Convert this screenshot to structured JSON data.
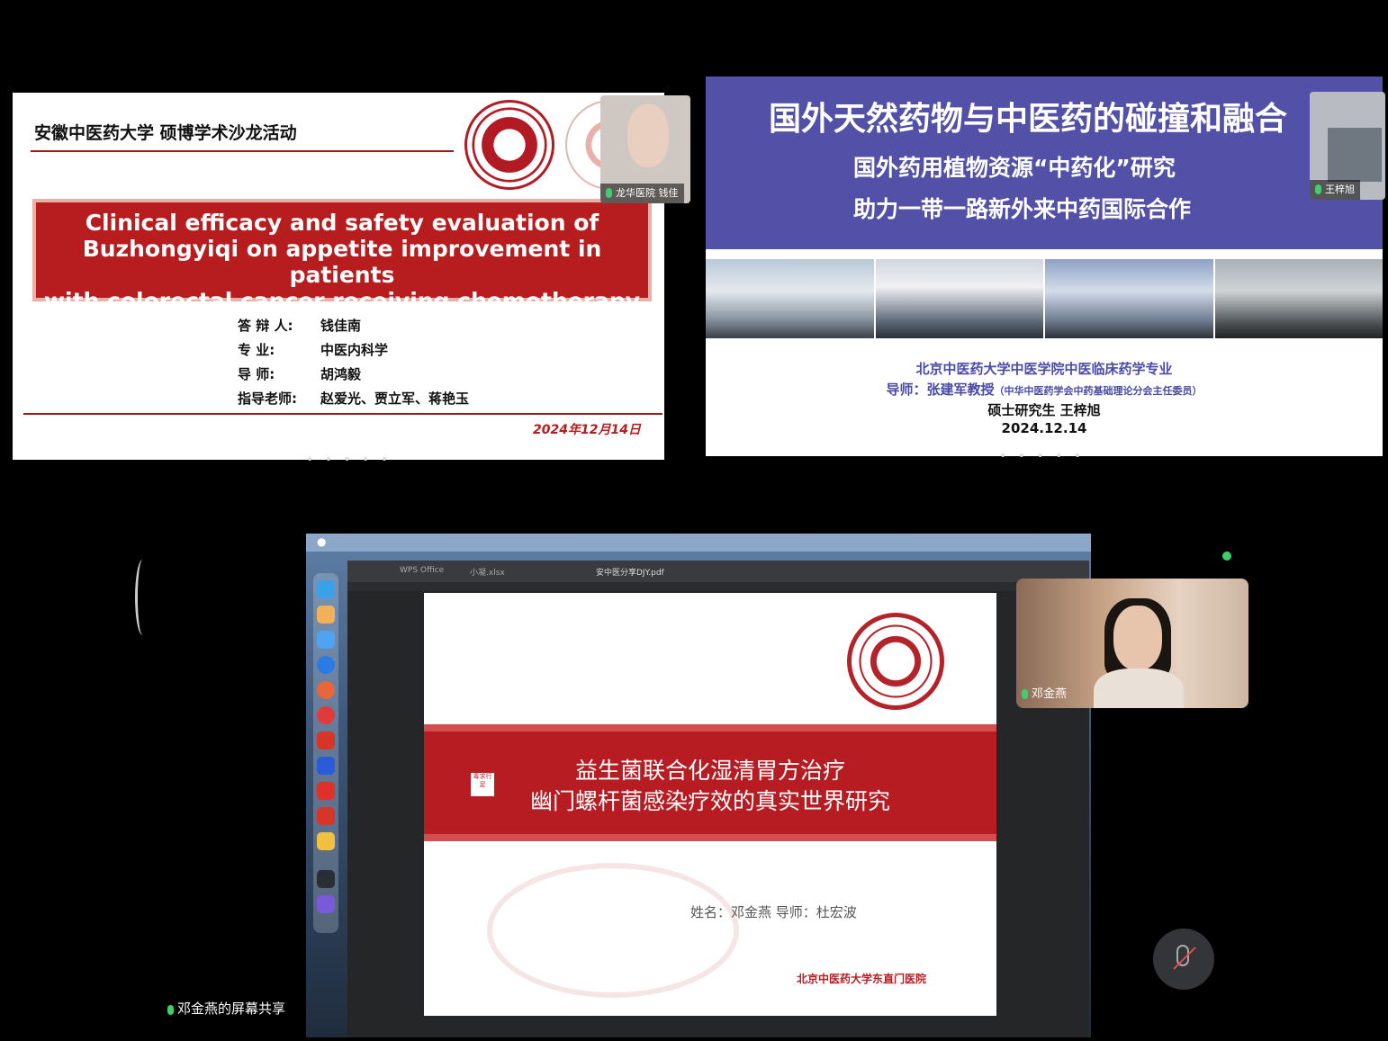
{
  "slide1": {
    "header": "安徽中医药大学 硕博学术沙龙活动",
    "title_lines": [
      "Clinical efficacy and safety evaluation of",
      "Buzhongyiqi on appetite improvement in patients",
      "with colorectal cancer receiving chemotherapy"
    ],
    "rows": [
      {
        "k": "答 辩 人:",
        "v": "钱佳南"
      },
      {
        "k": "专    业:",
        "v": "中医内科学"
      },
      {
        "k": "导    师:",
        "v": "胡鸿毅"
      },
      {
        "k": "指导老师:",
        "v": "赵爱光、贾立军、蒋艳玉"
      }
    ],
    "date": "2024年12月14日"
  },
  "tile1_cam_label": "龙华医院 钱佳",
  "slide2": {
    "title": "国外天然药物与中医药的碰撞和融合",
    "sub1": "国外药用植物资源“中药化”研究",
    "sub2": "助力一带一路新外来中药国际合作",
    "line1": "北京中医药大学中医学院中医临床药学专业",
    "line2": "导师：张建军教授",
    "line2_small": "（中华中医药学会中药基础理论分会主任委员）",
    "line3": "硕士研究生  王梓旭",
    "line4": "2024.12.14"
  },
  "tile2_cam_label": "王梓旭",
  "share": {
    "tabs": [
      "WPS Office",
      "小凝.xlsx",
      "安中医分享DJY.pdf"
    ],
    "slide3": {
      "title1": "益生菌联合化湿清胃方治疗",
      "title2": "幽门螺杆菌感染疗效的真实世界研究",
      "stamp": "毒求行足",
      "names": "姓名：邓金燕    导师：杜宏波",
      "institution": "北京中医药大学东直门医院"
    }
  },
  "presenter_label": "邓金燕",
  "share_label": "邓金燕的屏幕共享",
  "dots": "• • • • •",
  "colors": {
    "red": "#b71d1f",
    "purple": "#5350a8",
    "green": "#3bd06a"
  }
}
